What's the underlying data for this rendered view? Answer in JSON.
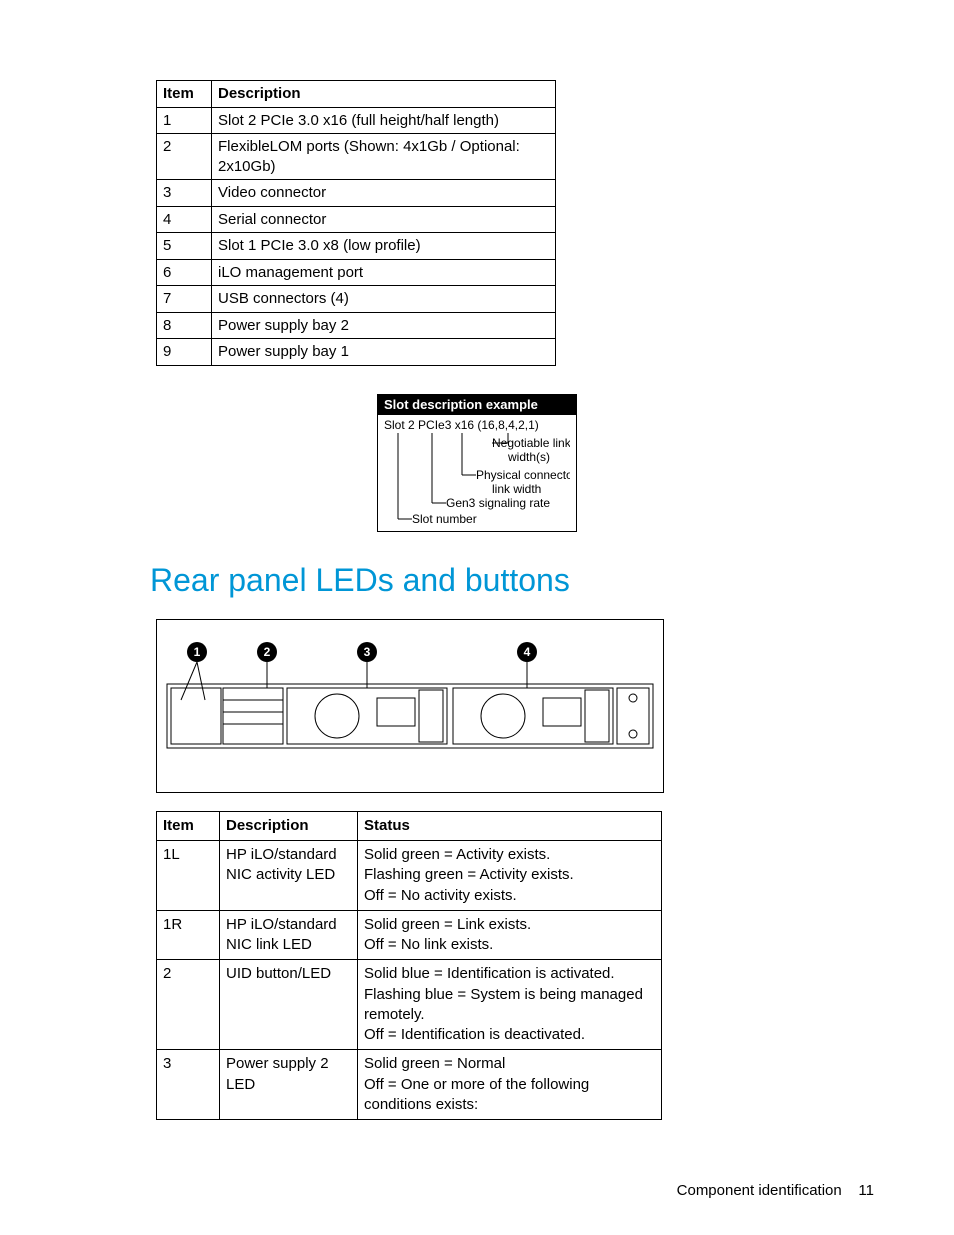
{
  "table1": {
    "headers": {
      "item": "Item",
      "desc": "Description"
    },
    "rows": [
      {
        "item": "1",
        "desc": "Slot 2 PCIe 3.0 x16 (full height/half length)"
      },
      {
        "item": "2",
        "desc": "FlexibleLOM ports (Shown: 4x1Gb / Optional: 2x10Gb)"
      },
      {
        "item": "3",
        "desc": "Video connector"
      },
      {
        "item": "4",
        "desc": "Serial connector"
      },
      {
        "item": "5",
        "desc": "Slot 1 PCIe 3.0 x8 (low profile)"
      },
      {
        "item": "6",
        "desc": "iLO management port"
      },
      {
        "item": "7",
        "desc": "USB connectors (4)"
      },
      {
        "item": "8",
        "desc": "Power supply bay 2"
      },
      {
        "item": "9",
        "desc": "Power supply bay 1"
      }
    ]
  },
  "slot_box": {
    "header": "Slot description example",
    "example": "Slot 2 PCIe3 x16 (16,8,4,2,1)",
    "labels": {
      "negotiable": "Negotiable link width(s)",
      "physical": "Physical connector link width",
      "signaling": "Gen3 signaling rate",
      "slot": "Slot number"
    }
  },
  "section_title": "Rear panel LEDs and buttons",
  "figure": {
    "callouts": [
      "1",
      "2",
      "3",
      "4"
    ]
  },
  "table2": {
    "headers": {
      "item": "Item",
      "desc": "Description",
      "status": "Status"
    },
    "rows": [
      {
        "item": "1L",
        "desc": "HP iLO/standard NIC activity LED",
        "status": "Solid green = Activity exists.\nFlashing green = Activity exists.\nOff = No activity exists."
      },
      {
        "item": "1R",
        "desc": "HP iLO/standard NIC link LED",
        "status": "Solid green = Link exists.\nOff = No link exists."
      },
      {
        "item": "2",
        "desc": "UID button/LED",
        "status": "Solid blue = Identification is activated.\nFlashing blue = System is being managed remotely.\nOff = Identification is deactivated."
      },
      {
        "item": "3",
        "desc": "Power supply 2 LED",
        "status": "Solid green = Normal\nOff = One or more of the following conditions exists:"
      }
    ]
  },
  "footer": {
    "section": "Component identification",
    "page": "11"
  }
}
